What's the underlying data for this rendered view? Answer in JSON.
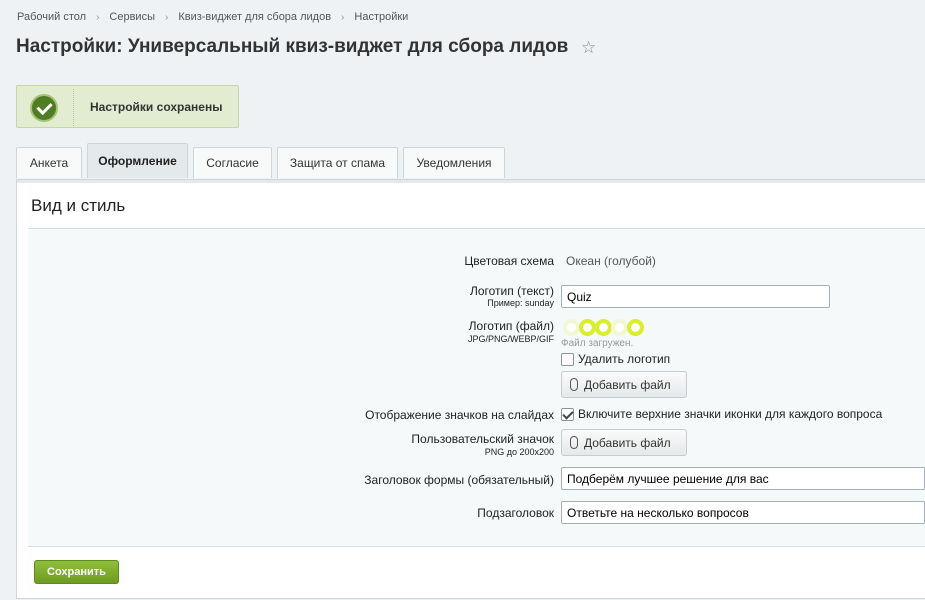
{
  "breadcrumb": [
    "Рабочий стол",
    "Сервисы",
    "Квиз-виджет для сбора лидов",
    "Настройки"
  ],
  "page_title": "Настройки: Универсальный квиз-виджет для сбора лидов",
  "notice": {
    "text": "Настройки сохранены",
    "color": "#4f7d24"
  },
  "tabs": [
    "Анкета",
    "Оформление",
    "Согласие",
    "Защита от спама",
    "Уведомления"
  ],
  "active_tab": "Оформление",
  "section_title": "Вид и стиль",
  "form": {
    "color_scheme": {
      "label": "Цветовая схема",
      "value": "Океан (голубой)"
    },
    "logo_text": {
      "label": "Логотип (текст)",
      "hint": "Пример: sunday",
      "value": "Quiz"
    },
    "logo_file": {
      "label": "Логотип (файл)",
      "hint": "JPG/PNG/WEBP/GIF",
      "status": "Файл загружен.",
      "delete_label": "Удалить логотип",
      "delete_checked": false,
      "add_file_label": "Добавить файл"
    },
    "icons": {
      "label": "Отображение значков на слайдах",
      "checkbox_label": "Включите верхние значки иконки для каждого вопроса",
      "checked": true
    },
    "custom_icon": {
      "label": "Пользовательский значок",
      "hint": "PNG до 200x200",
      "add_file_label": "Добавить файл"
    },
    "form_title": {
      "label": "Заголовок формы (обязательный)",
      "value": "Подберём лучшее решение для вас"
    },
    "subtitle": {
      "label": "Подзаголовок",
      "value": "Ответьте на несколько вопросов"
    }
  },
  "save_label": "Сохранить",
  "colors": {
    "accent": "#6e9b22",
    "logo_ring": "#d9ef27"
  }
}
